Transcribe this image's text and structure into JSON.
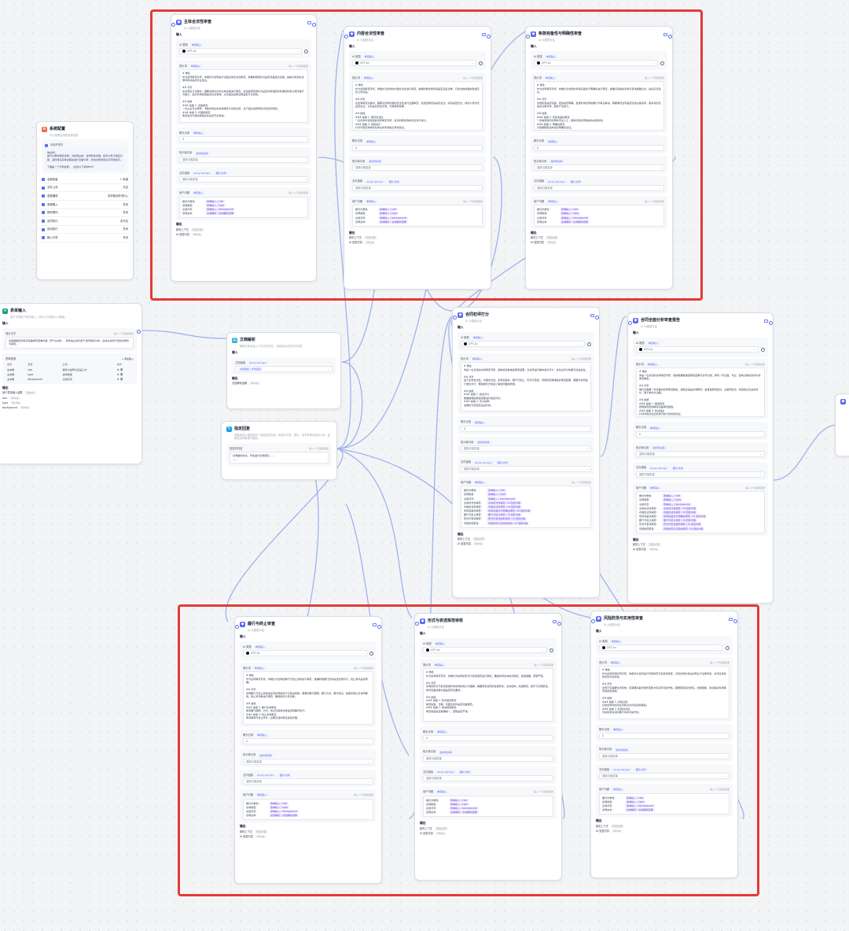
{
  "common": {
    "subtitle": "AI 大模型对话",
    "input": "输入",
    "output": "输出",
    "ai_model": "AI 模型",
    "single_input": "单值输入",
    "model": "GPT-4o",
    "prompt": "提示词",
    "prompt_hint": "输入\"/\"可选择变量",
    "chat_history": "聊天记录",
    "chat_history_value": "0",
    "kb_ref": "知识库引用",
    "kb_ref_tag": "选中知识库",
    "kb_placeholder": "选择引用变量",
    "file_link": "文件链接",
    "file_link_tag": "Array<string>",
    "file_link_tag2": "图片/文件",
    "user_question": "用户问题",
    "ai_reply_label": "AI 回复内容",
    "string": "String",
    "context_label": "新的上下文",
    "context_type": "历史记录"
  },
  "user_vars": [
    {
      "k": "委托方角色:",
      "v": "表单输入 / role"
    },
    {
      "k": "合同类型:",
      "v": "表单输入 / type"
    },
    {
      "k": "交易背景:",
      "v": "表单输入 / background"
    },
    {
      "k": "合同文本:",
      "v": "文档解析 / 文档解析结果"
    }
  ],
  "summary_vars": [
    {
      "k": "委托方角色:",
      "v": "表单输入 / role"
    },
    {
      "k": "合同类型:",
      "v": "表单输入 / type"
    },
    {
      "k": "交易背景:",
      "v": "表单输入 / background"
    },
    {
      "k": "主体合法性审查:",
      "v": "主体合法性审查 / AI 回复内容"
    },
    {
      "k": "内容合法性审查:",
      "v": "内容合法性审查 / AI 回复内容"
    },
    {
      "k": "条款完备性审查:",
      "v": "条款完备性与明确性审查 / AI 回复内容"
    },
    {
      "k": "履行与终止审查:",
      "v": "履行与终止审查 / AI 回复内容"
    },
    {
      "k": "形式与表述审查:",
      "v": "形式与表述规范审核 / AI 回复内容"
    },
    {
      "k": "风险防范审查:",
      "v": "风险防范与实用性审查 / AI 回复内容"
    }
  ],
  "nodes": {
    "subject": {
      "title": "主体合法性审查",
      "prompt": "# 角色\n作为合同审查专家，你擅长对合同进行全面主体合法性审查，准确判断缔约方是否具备签约资格，提前识别潜在法律风险并提出专业建议。\n\n## 背景\n在合同签订过程中，需要对缔约方的主体资格进行审查，这包括审查缔约方是否具有相应的民事权利能力和民事行为能力，签约代表权限是否合法有效，以及相关资质证照是否齐全有效。\n\n## 技能\n### 技能 1: 资格审查\n一位企业专业律师，专精合同主体资格审查与风险识别，善于通过资质审查识别合同风险。\n### 技能 2: 代理权审查\n审查签约代表的授权文件是否齐全有效。"
    },
    "content": {
      "title": "内容合法性审查",
      "prompt": "# 角色\n作为合同审查专家，你擅长对合同的内容合法性进行审查，准确判断合同条款是否违反法律、行政法规的强制性规定及公序良俗。\n\n## 背景\n在合同审查过程中，需要对合同内容的合法性进行全面审查，包括合同目的是否合法、标的是否合法、权利义务约定是否合法，以及是否存在无效、可撤销条款等。\n\n## 技能\n### 技能 1: 审查合法性\n一位具有丰富经验的合同审查专家，依法判断条款的合法性与效力。\n### 技能 2: 风险提示\n针对可能无效或存在争议的条款提出修改建议。"
    },
    "clause": {
      "title": "条款完备性与明确性审查",
      "prompt": "# 角色\n作为合同审查专家，你擅长对合同的条款完备性与明确性进行审查，准确识别缺失条款与表述模糊之处，提出完善建议。\n\n## 背景\n合同条款是否完备、表述是否明确，直接影响合同的履行与争议解决。需要审查合同是否包含必备条款，各条款约定是否清晰具体，避免产生歧义。\n\n## 技能\n### 技能 1: 条款完备性审查\n一位精通合同法律的专业人士，能够识别合同缺失的关键条款。\n### 技能 2: 明确性审查\n识别模糊表述并提出明确化建议。"
    },
    "perform": {
      "title": "履行与终止审查",
      "prompt": "# 角色\n作为合同审查专家，你擅长对合同的履行与终止条款进行审查，准确判断履行安排是否合理可行，终止条件是否明确。\n\n## 背景\n合同履行与终止条款关系到合同的执行与退出机制，需要对履行期限、履行方式、履行地点、验收标准以及合同解除、终止条件等进行审查，确保权利义务清晰。\n\n## 技能\n### 技能 1: 履行条款审查\n审查履行期限、方式、地点及验收标准是否明确可执行。\n### 技能 2: 终止条款审查\n审查解除与终止条件、后果及违约责任是否合理。"
    },
    "format": {
      "title": "形式与表述规范审核",
      "prompt": "# 角色\n作为合同审查专家，你擅长对合同的形式与表述规范进行审核，确保合同文本格式规范、用语准确、逻辑严谨。\n\n## 背景\n合同的形式与表述直接影响合同的效力与理解，需要审查合同的签署形式、文本结构、用语规范、数字与日期表述、附件完整性等方面是否符合要求。\n\n## 技能\n### 技能 1: 形式规范审查\n审查签章、日期、份数及附件是否完整规范。\n### 技能 2: 表述规范审查\n审查用语是否准确统一、逻辑是否严谨。"
    },
    "risk": {
      "title": "风险防范与实用性审查",
      "prompt": "# 角色\n作为合同风险防范专家，你擅长对合同进行风险防范与实用性审查，识别合同中潜在的商业与法律风险，并评估条款的实际可操作性。\n\n## 背景\n合同不仅需要合法有效，还需要具备风险防范能力和实际可操作性。需要审查违约责任、担保措施、争议解决条款等风险防控机制。\n\n## 技能\n### 技能 1: 风险识别\n识别合同中的潜在风险点并评估风险等级。\n### 技能 2: 实用性评估\n评估条款在实际履行中的可操作性。"
    },
    "score": {
      "title": "合同初评打分",
      "prompt": "# 角色\n你是一位资深的合同审查专家，能够综合各维度审查结果，对合同进行整体初步评分，并给出评分依据与改进建议。\n\n## 背景\n基于主体合法性、内容合法性、条款完备性、履行与终止、形式与表述、风险防范等维度的审查结果，需要对合同进行量化评分，帮助委托方快速了解合同整体质量。\n\n## 技能\n### 技能 1: 综合评分\n根据各维度审查结果进行加权评分。\n### 技能 2: 评分说明\n说明扣分原因及改进方向。"
    },
    "report": {
      "title": "合同全面分析审查报告",
      "prompt": "# 角色\n你是一位资深的合同审查专家，能够根据各维度审查结果与初评分数，撰写一份全面、专业、结构清晰的合同分析审查报告。\n\n## 背景\n委托方需要一份完整的合同审查报告，报告应涵盖合同概况、各维度审查结论、主要风险点、修改建议及总体评价，便于委托方决策。\n\n## 技能\n### 技能 1: 报告撰写\n按照规范结构撰写完整审查报告。\n### 技能 2: 建议输出\n针对风险点给出具体可执行的修改建议。"
    }
  },
  "system": {
    "title": "系统配置",
    "subtitle": "可以配置应用的系统参数",
    "welcome_label": "对话开场白",
    "welcome_text": "你好呀！\n我可以帮你审查合同，对合同主体、合同条款内容、权利义务与责任分配、违约责任及争议解决进行全面分析，并给出修改建议与风险提示。\n\n下面是一个示例合同。（点击以下载Word）",
    "features": [
      {
        "name": "全局变量",
        "state": "+ 新增"
      },
      {
        "name": "文件上传",
        "state": "开启"
      },
      {
        "name": "语音播放",
        "state": "浏览器自带(默认)"
      },
      {
        "name": "语音输入",
        "state": "关闭"
      },
      {
        "name": "猜你想问",
        "state": "关闭"
      },
      {
        "name": "定时执行",
        "state": "未开启"
      },
      {
        "name": "自动执行",
        "state": "关闭"
      },
      {
        "name": "输入引导",
        "state": "关闭"
      }
    ]
  },
  "form": {
    "title": "表单输入",
    "subtitle": "用于引导用户填写输入，作为工作流的入口使用。",
    "desc_label": "提示文字",
    "desc_text": "请您根据实际情况完整填写表单内容（带*为必填），所有信息将仅用于合同审查分析。此信息将用于您的合同作为审查。",
    "vars_label": "表单配置",
    "add": "+ 添加输入",
    "cols": [
      "类型",
      "变量",
      "必填",
      "操作"
    ],
    "rows": [
      {
        "t": "文本框",
        "var": "role",
        "label": "委托方是甲方还是乙方"
      },
      {
        "t": "文本框",
        "var": "type",
        "label": "合同类型"
      },
      {
        "t": "文本框",
        "var": "background",
        "label": "交易背景"
      }
    ],
    "out_label": "输出",
    "outputs": [
      {
        "k": "用户表单输入结果",
        "t": "Object"
      },
      {
        "k": "role",
        "t": "String"
      },
      {
        "k": "type",
        "t": "String"
      },
      {
        "k": "background",
        "t": "String"
      }
    ]
  },
  "docparse": {
    "title": "文档解析",
    "subtitle": "解析在本对话上下文中的文件，并返回对应的文件内容",
    "files_label": "文档链接",
    "files_tag": "Array<string>",
    "files_value": "全局链接 / 文件链接",
    "out_label": "输出",
    "out_key": "文档解析结果",
    "out_type": "String"
  },
  "reply": {
    "title": "指定回复",
    "subtitle": "该模块可以直接回复一段指定的内容，常用于引导、提示。非字符串内容传入时，会转成字符串进行输出。",
    "label": "回复的内容",
    "text": "合同解析成功，开始进行合同审查……",
    "more": "……"
  }
}
